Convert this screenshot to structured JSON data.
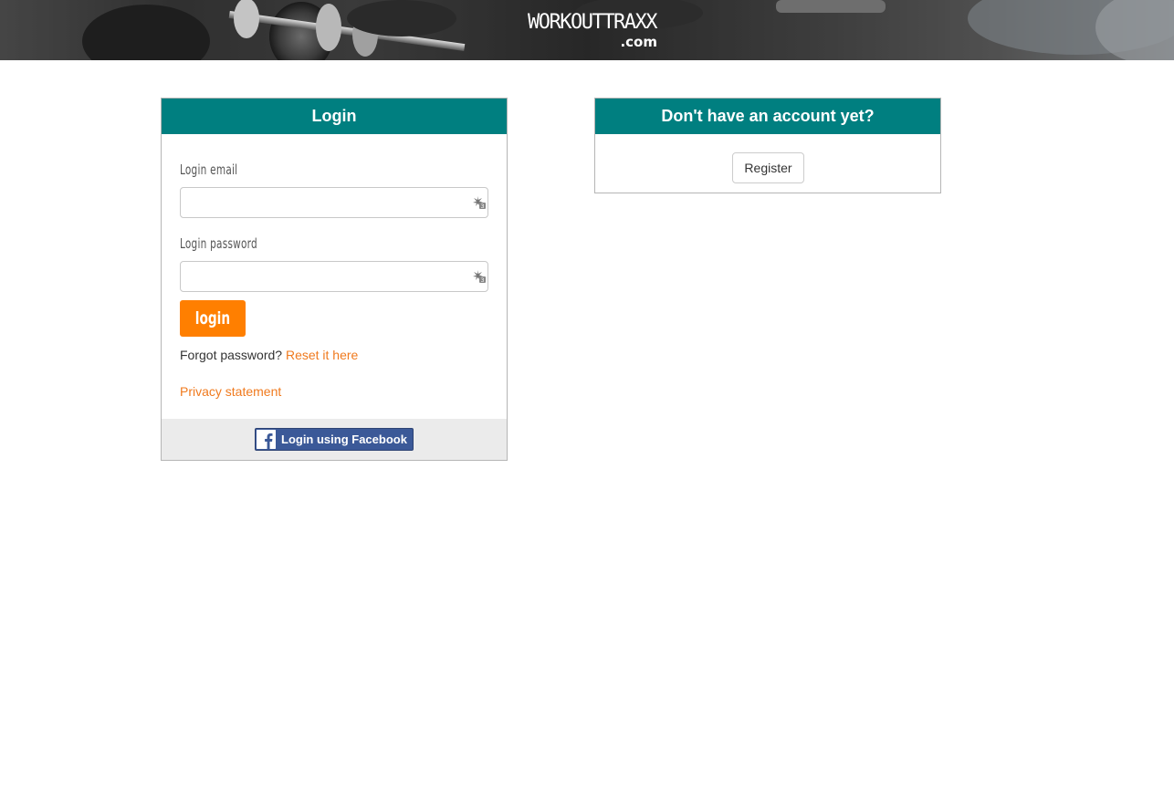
{
  "header": {
    "logo_main": "WORKOUTTRAXX",
    "logo_sub": ".com"
  },
  "login": {
    "title": "Login",
    "email_label": "Login email",
    "email_value": "",
    "password_label": "Login password",
    "password_value": "",
    "submit_label": "login",
    "forgot_text": "Forgot password?",
    "reset_link": "Reset it here",
    "privacy_link": "Privacy statement",
    "facebook_label": "Login using Facebook"
  },
  "register": {
    "title": "Don't have an account yet?",
    "button_label": "Register"
  },
  "colors": {
    "accent": "#007f80",
    "primary_button": "#ff7f00",
    "link": "#f07a1e",
    "facebook": "#3b5998"
  },
  "icons": {
    "field_icon": "password-manager-key-icon",
    "facebook_icon": "facebook-f-icon"
  }
}
